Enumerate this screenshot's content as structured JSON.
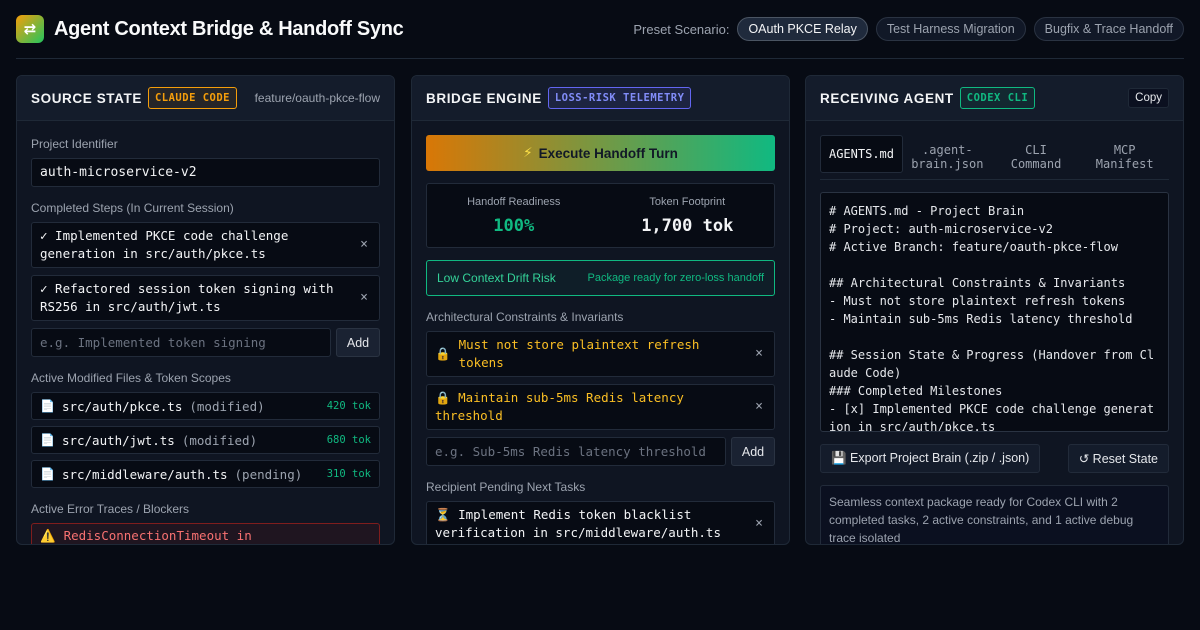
{
  "header": {
    "logo_glyph": "⇄",
    "title": "Agent Context Bridge & Handoff Sync",
    "preset_label": "Preset Scenario:",
    "presets": [
      "OAuth PKCE Relay",
      "Test Harness Migration",
      "Bugfix & Trace Handoff"
    ],
    "active_preset": "OAuth PKCE Relay"
  },
  "source": {
    "title": "SOURCE STATE",
    "badge": "CLAUDE CODE",
    "branch": "feature/oauth-pkce-flow",
    "project_label": "Project Identifier",
    "project_value": "auth-microservice-v2",
    "steps_label": "Completed Steps (In Current Session)",
    "steps": [
      "✓ Implemented PKCE code challenge generation in src/auth/pkce.ts",
      "✓ Refactored session token signing with RS256 in src/auth/jwt.ts"
    ],
    "step_placeholder": "e.g. Implemented token signing",
    "add_label": "Add",
    "files_label": "Active Modified Files & Token Scopes",
    "files": [
      {
        "path": "src/auth/pkce.ts",
        "status": "(modified)",
        "tokens": "420 tok"
      },
      {
        "path": "src/auth/jwt.ts",
        "status": "(modified)",
        "tokens": "680 tok"
      },
      {
        "path": "src/middleware/auth.ts",
        "status": "(pending)",
        "tokens": "310 tok"
      }
    ],
    "errors_label": "Active Error Traces / Blockers",
    "error_text": "RedisConnectionTimeout in"
  },
  "bridge": {
    "title": "BRIDGE ENGINE",
    "badge": "LOSS-RISK TELEMETRY",
    "execute_label": "Execute Handoff Turn",
    "readiness_label": "Handoff Readiness",
    "readiness_value": "100%",
    "footprint_label": "Token Footprint",
    "footprint_value": "1,700 tok",
    "drift_risk": "Low Context Drift Risk",
    "drift_note": "Package ready for zero-loss handoff",
    "constraints_label": "Architectural Constraints & Invariants",
    "constraints": [
      "Must not store plaintext refresh tokens",
      "Maintain sub-5ms Redis latency threshold"
    ],
    "constraint_placeholder": "e.g. Sub-5ms Redis latency threshold",
    "add_label": "Add",
    "tasks_label": "Recipient Pending Next Tasks",
    "tasks": [
      "⏳ Implement Redis token blacklist verification in src/middleware/auth.ts"
    ]
  },
  "receiver": {
    "title": "RECEIVING AGENT",
    "badge": "CODEX CLI",
    "copy_label": "Copy",
    "tabs": [
      "AGENTS.md",
      ".agent-brain.json",
      "CLI Command",
      "MCP Manifest"
    ],
    "active_tab": "AGENTS.md",
    "code": "# AGENTS.md - Project Brain\n# Project: auth-microservice-v2\n# Active Branch: feature/oauth-pkce-flow\n\n## Architectural Constraints & Invariants\n- Must not store plaintext refresh tokens\n- Maintain sub-5ms Redis latency threshold\n\n## Session State & Progress (Handover from Claude Code)\n### Completed Milestones\n- [x] Implemented PKCE code challenge generation in src/auth/pkce.ts",
    "export_label": "💾 Export Project Brain (.zip / .json)",
    "reset_label": "↺ Reset State",
    "summary": "Seamless context package ready for Codex CLI with 2 completed tasks, 2 active constraints, and 1 active debug trace isolated"
  }
}
